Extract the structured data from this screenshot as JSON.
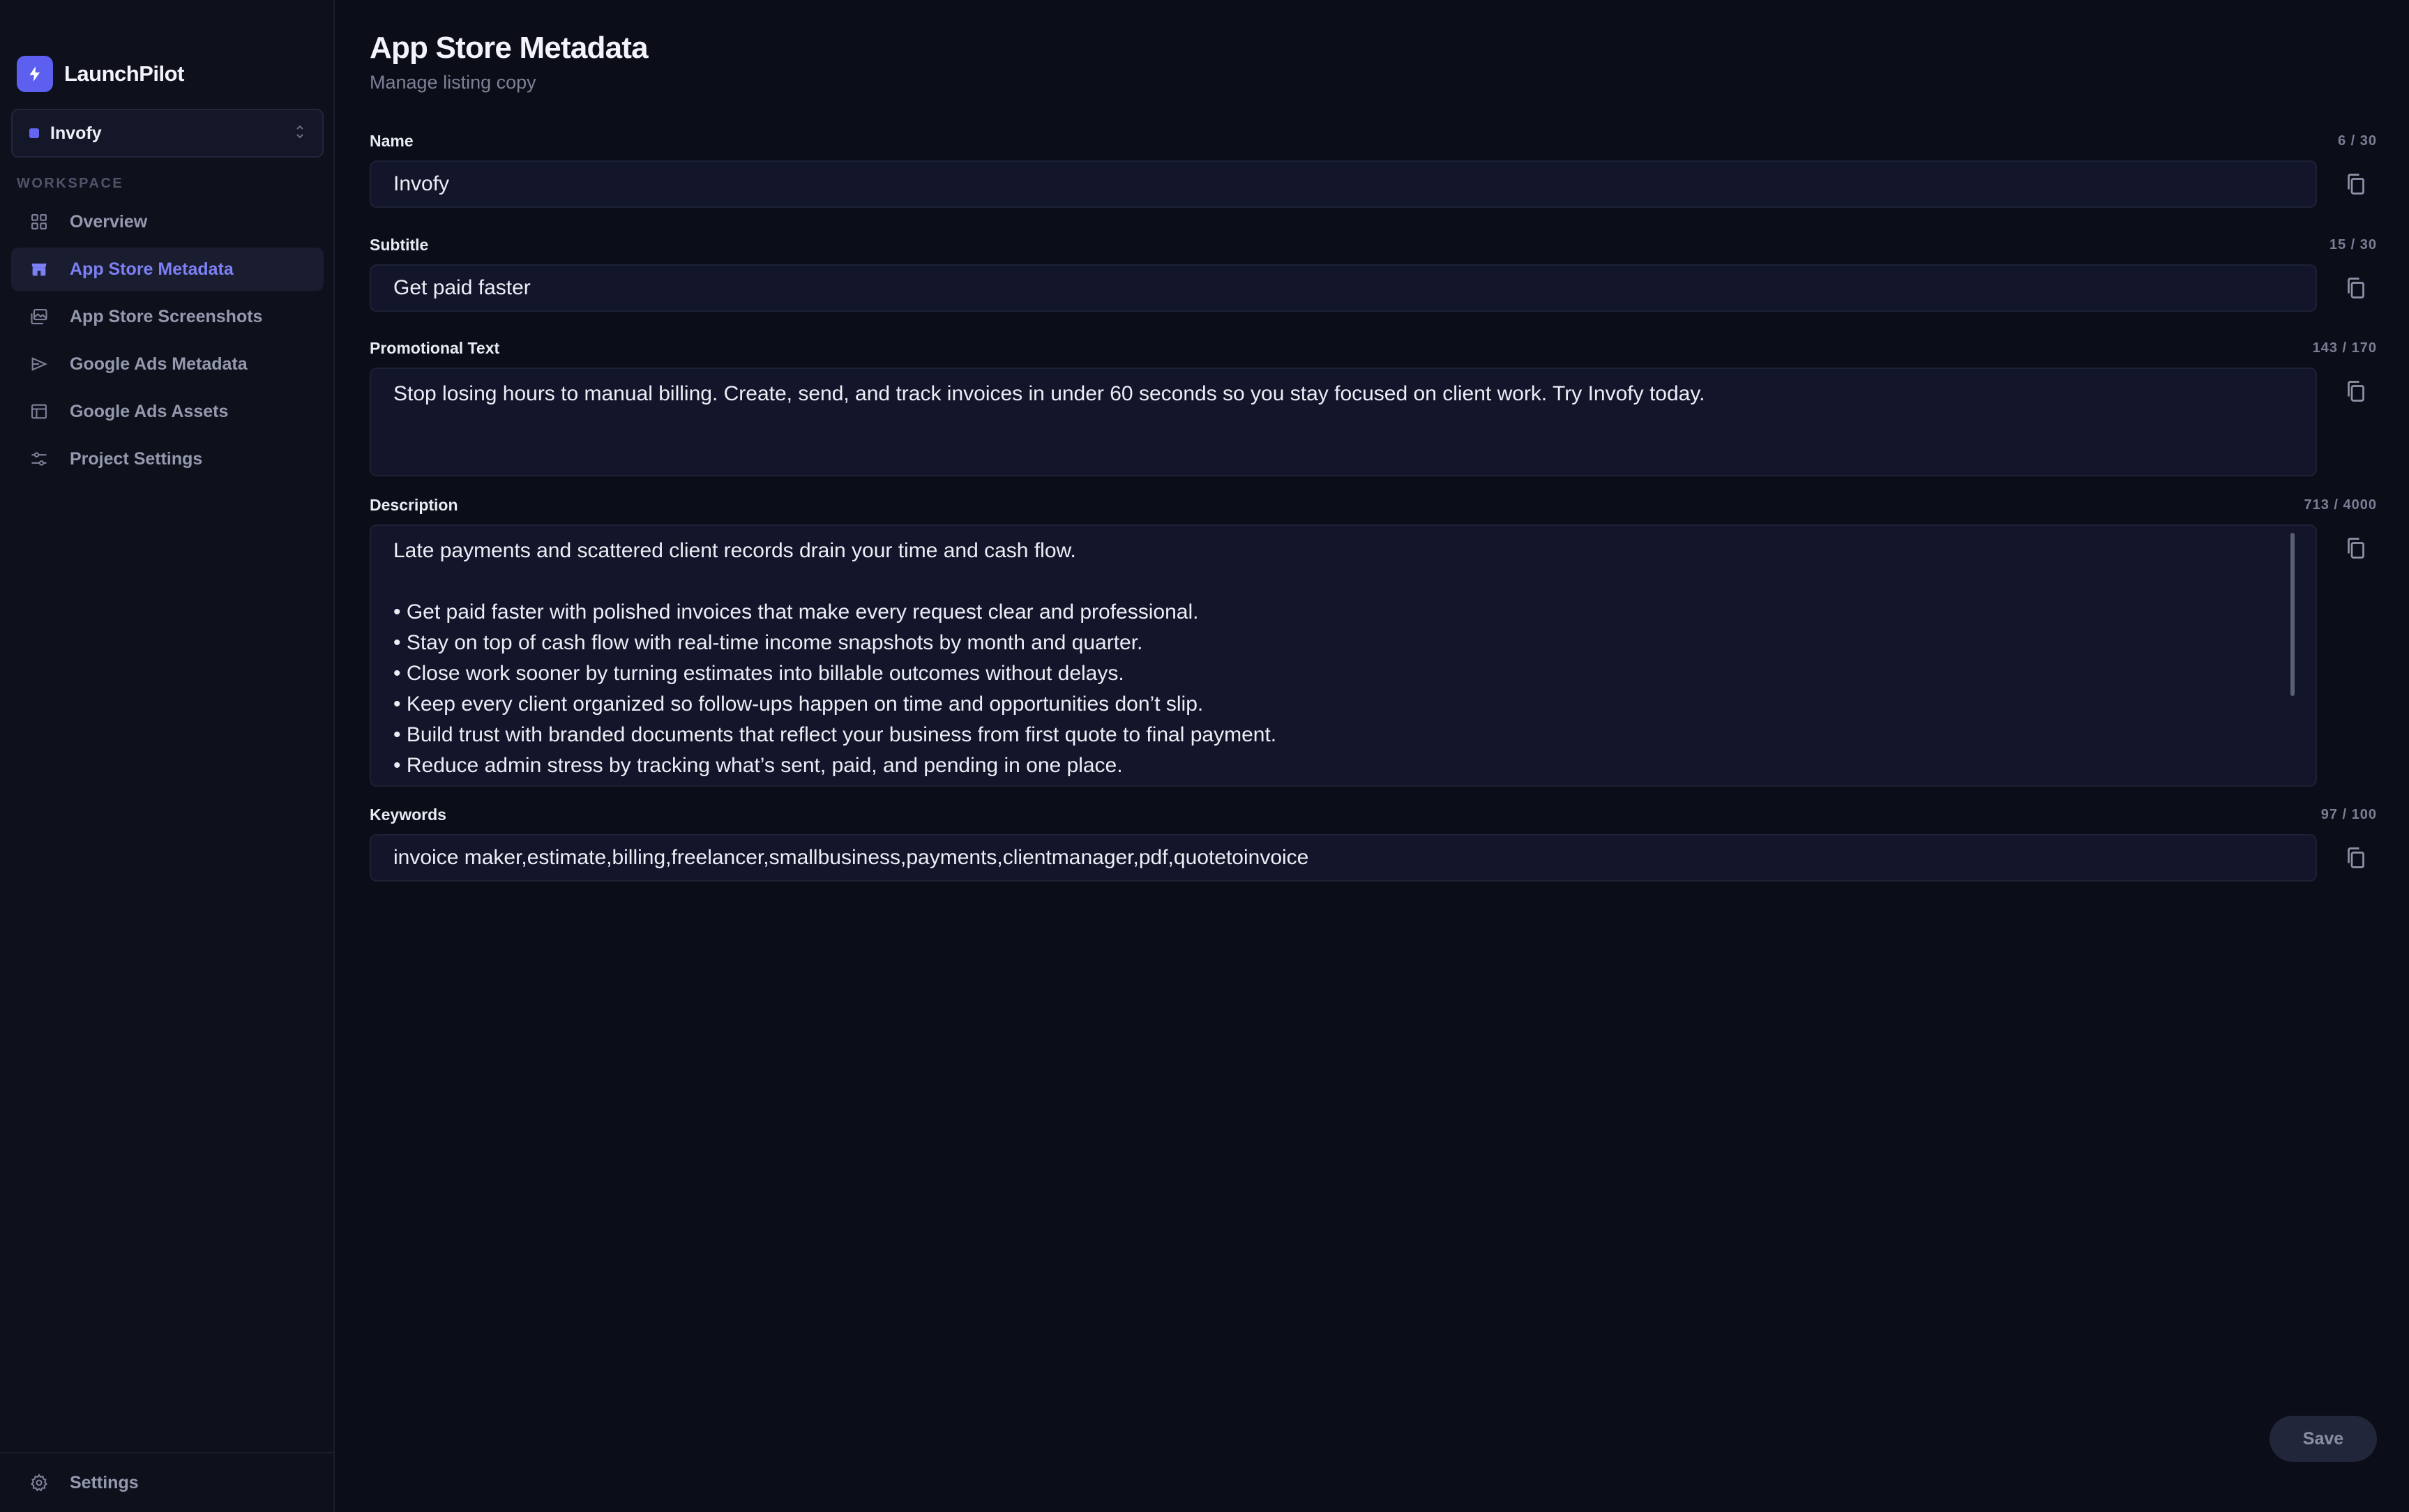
{
  "brand": {
    "name": "LaunchPilot",
    "logo_icon": "bolt-icon",
    "accent": "#5d5fef"
  },
  "project": {
    "name": "Invofy",
    "dot_color": "#6366f1"
  },
  "sidebar": {
    "section_label": "WORKSPACE",
    "items": [
      {
        "label": "Overview",
        "icon": "grid-icon",
        "active": false
      },
      {
        "label": "App Store Metadata",
        "icon": "store-icon",
        "active": true
      },
      {
        "label": "App Store Screenshots",
        "icon": "images-icon",
        "active": false
      },
      {
        "label": "Google Ads Metadata",
        "icon": "megaphone-icon",
        "active": false
      },
      {
        "label": "Google Ads Assets",
        "icon": "layout-icon",
        "active": false
      },
      {
        "label": "Project Settings",
        "icon": "sliders-icon",
        "active": false
      }
    ],
    "footer": {
      "label": "Settings",
      "icon": "gear-icon"
    }
  },
  "page": {
    "title": "App Store Metadata",
    "subtitle": "Manage listing copy"
  },
  "fields": {
    "name": {
      "label": "Name",
      "count": "6 / 30",
      "value": "Invofy"
    },
    "subtitle": {
      "label": "Subtitle",
      "count": "15 / 30",
      "value": "Get paid faster"
    },
    "promo": {
      "label": "Promotional Text",
      "count": "143 / 170",
      "value": "Stop losing hours to manual billing. Create, send, and track invoices in under 60 seconds so you stay focused on client work. Try Invofy today."
    },
    "description": {
      "label": "Description",
      "count": "713 / 4000",
      "lines": [
        "Late payments and scattered client records drain your time and cash flow.",
        "",
        "• Get paid faster with polished invoices that make every request clear and professional.",
        "• Stay on top of cash flow with real-time income snapshots by month and quarter.",
        "• Close work sooner by turning estimates into billable outcomes without delays.",
        "• Keep every client organized so follow-ups happen on time and opportunities don’t slip.",
        "• Build trust with branded documents that reflect your business from first quote to final payment.",
        "• Reduce admin stress by tracking what’s sent, paid, and pending in one place."
      ]
    },
    "keywords": {
      "label": "Keywords",
      "count": "97 / 100",
      "value": "invoice maker,estimate,billing,freelancer,smallbusiness,payments,clientmanager,pdf,quotetoinvoice"
    }
  },
  "actions": {
    "save_label": "Save"
  }
}
